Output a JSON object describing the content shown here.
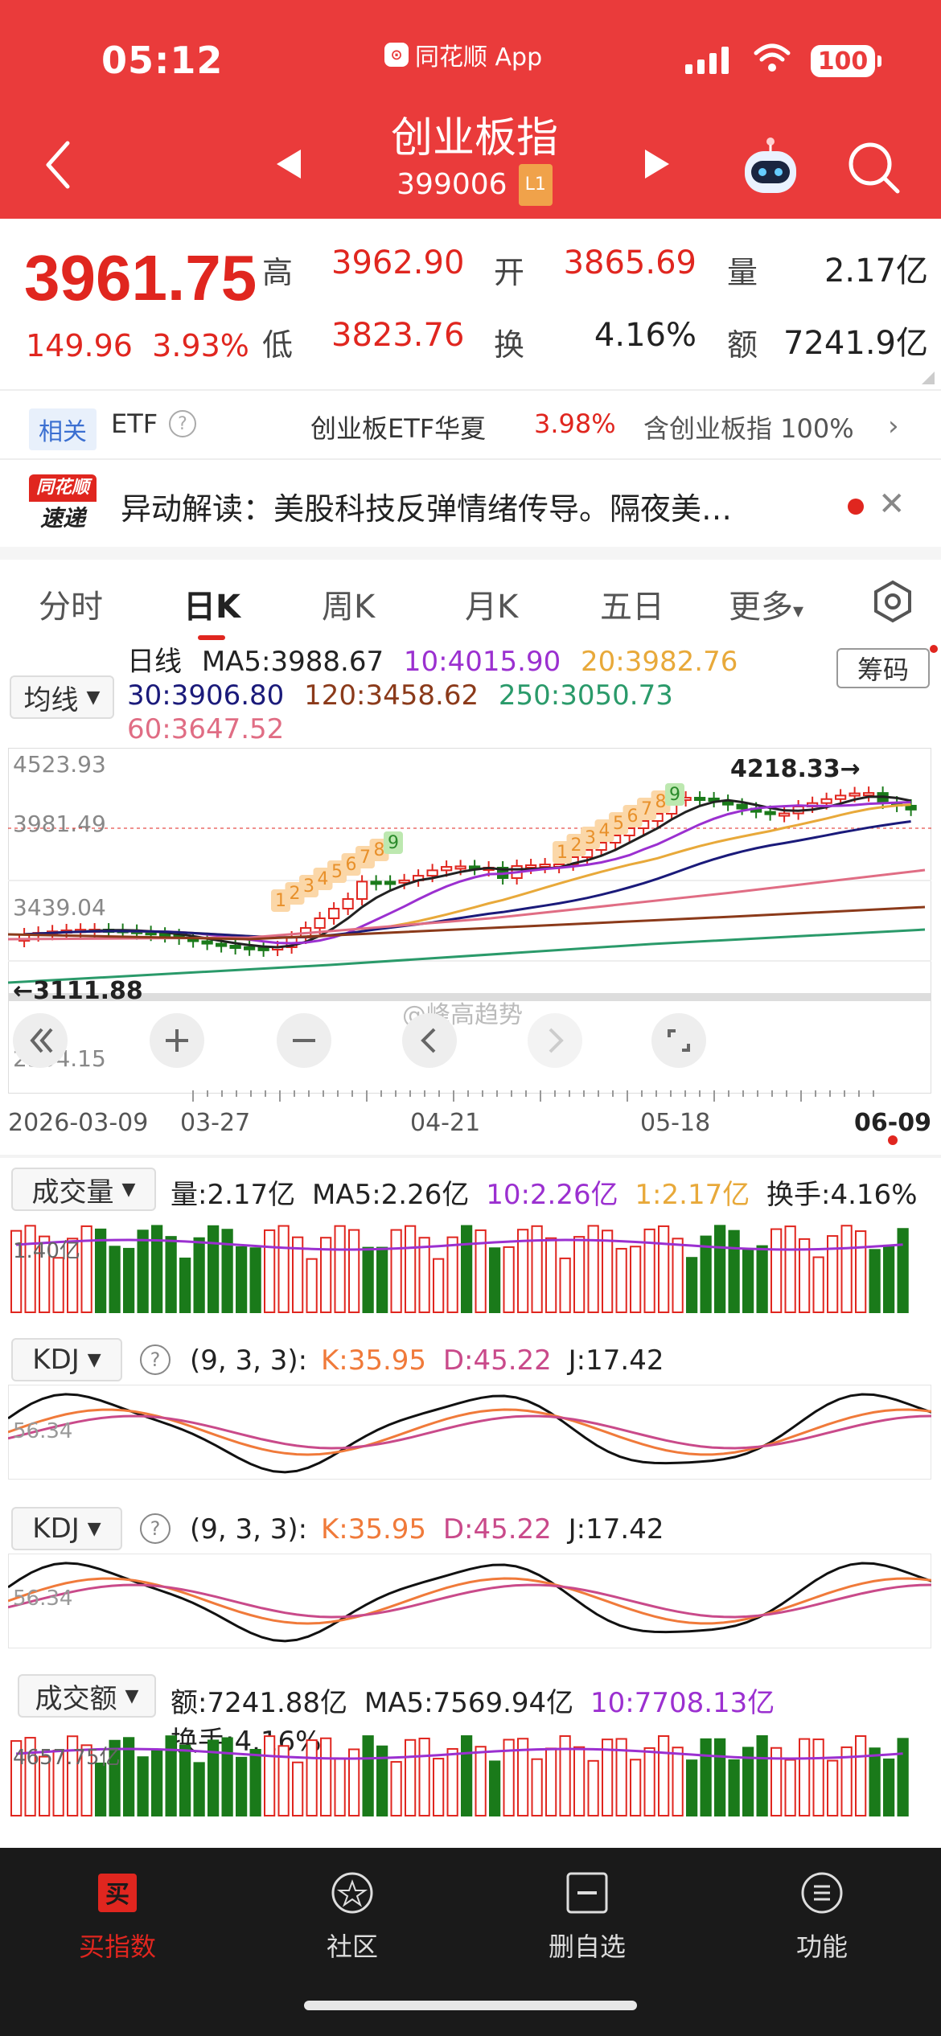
{
  "status_bar": {
    "time": "05:12",
    "app_name": "同花顺 App",
    "battery": "100"
  },
  "header": {
    "title": "创业板指",
    "code": "399006",
    "level": "L1"
  },
  "quote": {
    "price": "3961.75",
    "change": "149.96",
    "change_pct": "3.93%",
    "high_label": "高",
    "high": "3962.90",
    "open_label": "开",
    "open": "3865.69",
    "volume_label": "量",
    "volume": "2.17亿",
    "low_label": "低",
    "low": "3823.76",
    "turnover_label": "换",
    "turnover": "4.16%",
    "amount_label": "额",
    "amount": "7241.9亿"
  },
  "related": {
    "tag": "相关",
    "etf_label": "ETF",
    "etf_name": "创业板ETF华夏",
    "etf_pct": "3.98%",
    "contains": "含创业板指 100%"
  },
  "news": {
    "logo_top": "同花顺",
    "logo_bottom": "速递",
    "text": "异动解读：美股科技反弹情绪传导。隔夜美…"
  },
  "tabs": [
    "分时",
    "日K",
    "周K",
    "月K",
    "五日",
    "更多"
  ],
  "active_tab": "日K",
  "ma": {
    "select_label": "均线",
    "title": "日线",
    "ma5": "MA5:3988.67",
    "ma10": "10:4015.90",
    "ma20": "20:3982.76",
    "ma30": "30:3906.80",
    "ma120": "120:3458.62",
    "ma250": "250:3050.73",
    "ma60": "60:3647.52",
    "chips_button": "筹码"
  },
  "colors": {
    "up": "#e0261f",
    "down": "#1a7a1a",
    "ma5": "#222222",
    "ma10": "#9b30d0",
    "ma20": "#e8a93a",
    "ma30": "#1a1a7a",
    "ma60": "#e06d84",
    "ma120": "#8b3a1a",
    "ma250": "#2a9a6a"
  },
  "chart": {
    "y_top": "4523.93",
    "y_mid1": "3981.49",
    "y_mid2": "3439.04",
    "y_low_label": "3111.88",
    "y_bottom": "2354.15",
    "high_marker": "4218.33→",
    "watermark": "@峰高趋势",
    "dates": [
      "2026-03-09",
      "03-27",
      "04-21",
      "05-18",
      "06-09"
    ]
  },
  "chart_data": {
    "type": "candlestick",
    "x_range": [
      "2026-03-09",
      "2026-06-09"
    ],
    "y_range": [
      2354.15,
      4523.93
    ],
    "y_ticks": [
      4523.93,
      3981.49,
      3439.04,
      2354.15
    ],
    "annotations": [
      "4218.33",
      "3111.88"
    ],
    "td_sequence_1": [
      "1",
      "2",
      "3",
      "4",
      "5",
      "6",
      "7",
      "8",
      "9"
    ],
    "td_sequence_2": [
      "1",
      "2",
      "3",
      "4",
      "5",
      "6",
      "7",
      "8",
      "9"
    ],
    "last_close": 3961.75
  },
  "volume_panel": {
    "select": "成交量",
    "vol": "量:2.17亿",
    "ma5": "MA5:2.26亿",
    "ma10": "10:2.26亿",
    "ma1": "1:2.17亿",
    "turnover": "换手:4.16%",
    "axis": "1.40亿"
  },
  "kdj1": {
    "select": "KDJ",
    "params": "(9, 3, 3):",
    "k": "K:35.95",
    "d": "D:45.22",
    "j": "J:17.42",
    "axis": "56.34"
  },
  "kdj2": {
    "select": "KDJ",
    "params": "(9, 3, 3):",
    "k": "K:35.95",
    "d": "D:45.22",
    "j": "J:17.42",
    "axis": "56.34"
  },
  "amount_panel": {
    "select": "成交额",
    "amount": "额:7241.88亿",
    "ma5": "MA5:7569.94亿",
    "ma10": "10:7708.13亿",
    "turnover": "换手:4.16%",
    "axis": "4657.75亿"
  },
  "bottom_nav": [
    {
      "label": "买指数",
      "icon": "买"
    },
    {
      "label": "社区",
      "icon": ""
    },
    {
      "label": "删自选",
      "icon": ""
    },
    {
      "label": "功能",
      "icon": ""
    }
  ]
}
